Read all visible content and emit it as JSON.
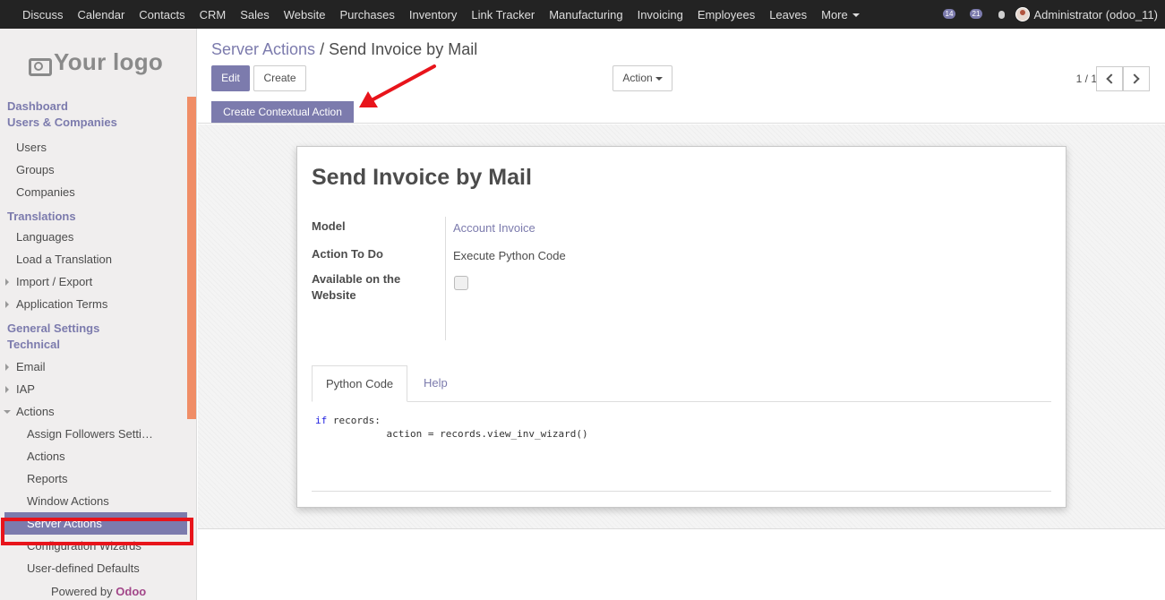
{
  "topbar": {
    "menu": [
      "Discuss",
      "Calendar",
      "Contacts",
      "CRM",
      "Sales",
      "Website",
      "Purchases",
      "Inventory",
      "Link Tracker",
      "Manufacturing",
      "Invoicing",
      "Employees",
      "Leaves",
      "More"
    ],
    "activity_badge": "14",
    "messages_badge": "21",
    "user": "Administrator (odoo_11)"
  },
  "sidebar": {
    "logo_text": "Your logo",
    "sections": {
      "dashboard": "Dashboard",
      "users_companies": "Users & Companies",
      "translations": "Translations",
      "general_settings": "General Settings",
      "technical": "Technical"
    },
    "items": {
      "users": "Users",
      "groups": "Groups",
      "companies": "Companies",
      "languages": "Languages",
      "load_translation": "Load a Translation",
      "import_export": "Import / Export",
      "application_terms": "Application Terms",
      "email": "Email",
      "iap": "IAP",
      "actions": "Actions",
      "assign_followers": "Assign Followers Setti…",
      "actions_sub": "Actions",
      "reports": "Reports",
      "window_actions": "Window Actions",
      "server_actions": "Server Actions",
      "config_wizards": "Configuration Wizards",
      "user_defaults": "User-defined Defaults"
    },
    "powered_by": "Powered by",
    "powered_brand": "Odoo"
  },
  "control_panel": {
    "breadcrumb_parent": "Server Actions",
    "breadcrumb_sep": "/",
    "breadcrumb_current": "Send Invoice by Mail",
    "edit_label": "Edit",
    "create_label": "Create",
    "action_label": "Action",
    "pager": "1 / 1",
    "contextual_action_label": "Create Contextual Action"
  },
  "form": {
    "title": "Send Invoice by Mail",
    "model_label": "Model",
    "model_value": "Account Invoice",
    "action_to_do_label": "Action To Do",
    "action_to_do_value": "Execute Python Code",
    "website_label": "Available on the Website",
    "website_checked": false,
    "tabs": [
      "Python Code",
      "Help"
    ],
    "code_keyword": "if",
    "code_line1": " records:",
    "code_line2": "            action = records.view_inv_wizard()"
  },
  "colors": {
    "accent": "#7c7bad",
    "topbar": "#232323",
    "highlight": "#e8141b",
    "scrollbar": "#f08d66"
  }
}
